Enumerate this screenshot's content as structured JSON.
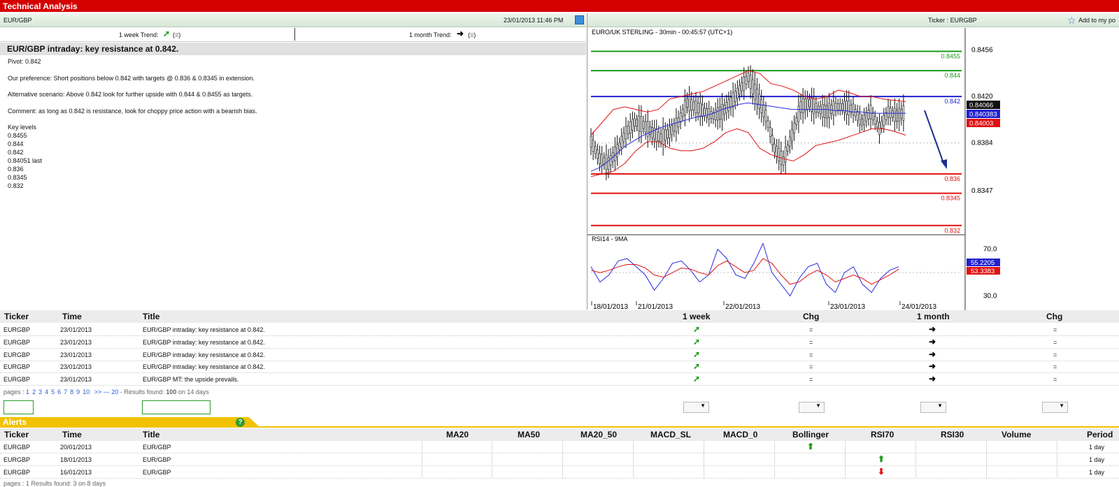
{
  "window": {
    "title": "Technical Analysis"
  },
  "header": {
    "pair": "EUR/GBP",
    "datetime": "23/01/2013 11:46 PM",
    "ticker_label": "Ticker : EURGBP",
    "add_label": "Add to my po"
  },
  "trends": {
    "week_label": "1 week Trend:",
    "week_suffix": "(=)",
    "month_label": "1 month Trend:",
    "month_suffix": "(=)"
  },
  "analysis": {
    "title": "EUR/GBP intraday: key resistance at 0.842.",
    "pivot": "Pivot: 0.842",
    "preference": "Our preference: Short positions below 0.842 with targets @ 0.836 & 0.8345 in extension.",
    "alternative": "Alternative scenario: Above 0.842 look for further upside with 0.844 & 0.8455 as targets.",
    "comment": "Comment: as long as 0.842 is resistance, look for choppy price action with a bearish bias.",
    "key_levels_label": "Key levels",
    "key_levels": [
      "0.8455",
      "0.844",
      "0.842",
      "0.84051 last",
      "0.836",
      "0.8345",
      "0.832"
    ]
  },
  "chart_data": [
    {
      "type": "line",
      "title": "EURO/UK STERLING - 30min - 00:45:57 (UTC+1)",
      "ylim": [
        0.8315,
        0.8465
      ],
      "y_ticks": [
        "0.8456",
        "0.8420",
        "0.8384",
        "0.8347"
      ],
      "x_ticks": [
        "18/01/2013",
        "21/01/2013",
        "22/01/2013",
        "23/01/2013",
        "24/01/2013"
      ],
      "levels": [
        {
          "label": "0.8455",
          "value": 0.8455,
          "color": "#1a9a1a"
        },
        {
          "label": "0.844",
          "value": 0.844,
          "color": "#1a9a1a"
        },
        {
          "label": "0.842",
          "value": 0.842,
          "color": "#2020d0"
        },
        {
          "label": "0.836",
          "value": 0.836,
          "color": "#e01010"
        },
        {
          "label": "0.8345",
          "value": 0.8345,
          "color": "#e01010"
        },
        {
          "label": "0.832",
          "value": 0.832,
          "color": "#e01010"
        }
      ],
      "price_tags": [
        {
          "label": "0.84066",
          "color": "#111111"
        },
        {
          "label": "0.840383",
          "color": "#2020d0"
        },
        {
          "label": "0.84003",
          "color": "#e01010"
        }
      ],
      "series": [
        {
          "values": [
            0.8385,
            0.8372,
            0.8368,
            0.8378,
            0.8392,
            0.84,
            0.8398,
            0.8392,
            0.8388,
            0.8392,
            0.84,
            0.8415,
            0.8412,
            0.8408,
            0.8405,
            0.8408,
            0.8415,
            0.8425,
            0.8435,
            0.842,
            0.8405,
            0.838,
            0.837,
            0.839,
            0.8412,
            0.8415,
            0.841,
            0.8408,
            0.8412,
            0.8412,
            0.841,
            0.84,
            0.8408,
            0.8395,
            0.8408,
            0.8405,
            0.8408
          ]
        },
        {
          "values": [
            0.8362,
            0.8365,
            0.837,
            0.8376,
            0.8382,
            0.8386,
            0.839,
            0.8393,
            0.8396,
            0.8398,
            0.84,
            0.8402,
            0.8404,
            0.8405,
            0.8407,
            0.841,
            0.8412,
            0.8414,
            0.8415,
            0.8414,
            0.8413,
            0.8412,
            0.8411,
            0.841,
            0.841,
            0.841,
            0.841,
            0.841,
            0.8409,
            0.8409,
            0.8408,
            0.8408,
            0.8407,
            0.8407,
            0.8407,
            0.8407,
            0.8407
          ]
        },
        {
          "values": [
            0.839,
            0.84,
            0.841,
            0.8412,
            0.841,
            0.8408,
            0.841,
            0.8418,
            0.842,
            0.8422,
            0.8424,
            0.8428,
            0.8432,
            0.8436,
            0.844,
            0.8438,
            0.843,
            0.8428,
            0.8425,
            0.842,
            0.8418,
            0.842,
            0.8425,
            0.8423,
            0.842,
            0.842,
            0.8418,
            0.8417,
            0.8416
          ]
        },
        {
          "values": [
            0.8358,
            0.836,
            0.8362,
            0.8368,
            0.8378,
            0.8385,
            0.8385,
            0.838,
            0.8378,
            0.8378,
            0.838,
            0.8385,
            0.8392,
            0.8395,
            0.8392,
            0.838,
            0.8375,
            0.8372,
            0.837,
            0.8375,
            0.8382,
            0.8384,
            0.8386,
            0.8389,
            0.8392,
            0.8395,
            0.8395,
            0.8393,
            0.839
          ]
        }
      ]
    },
    {
      "type": "line",
      "title": "RSI14 - 9MA",
      "ylim": [
        25,
        80
      ],
      "y_ticks": [
        "70.0",
        "30.0"
      ],
      "price_tags": [
        {
          "label": "55.2205",
          "color": "#2020d0"
        },
        {
          "label": "53.3383",
          "color": "#e01010"
        }
      ],
      "series": [
        {
          "values": [
            55,
            42,
            48,
            60,
            62,
            55,
            48,
            35,
            45,
            58,
            60,
            52,
            42,
            48,
            70,
            62,
            48,
            45,
            58,
            75,
            50,
            40,
            30,
            45,
            55,
            58,
            40,
            33,
            50,
            55,
            40,
            33,
            45,
            52,
            55
          ]
        },
        {
          "values": [
            52,
            50,
            52,
            55,
            57,
            57,
            54,
            48,
            46,
            50,
            54,
            53,
            50,
            48,
            56,
            60,
            55,
            50,
            52,
            62,
            58,
            48,
            40,
            42,
            48,
            52,
            48,
            42,
            45,
            48,
            45,
            40,
            44,
            48,
            53
          ]
        }
      ]
    }
  ],
  "news_table": {
    "headers": [
      "Ticker",
      "Time",
      "Title",
      "1 week",
      "Chg",
      "1 month",
      "Chg"
    ],
    "rows": [
      {
        "ticker": "EURGBP",
        "time": "23/01/2013",
        "title": "EUR/GBP intraday: key resistance at 0.842.",
        "week": "up-right-arrow",
        "chg1": "=",
        "month": "right-arrow",
        "chg2": "="
      },
      {
        "ticker": "EURGBP",
        "time": "23/01/2013",
        "title": "EUR/GBP intraday: key resistance at 0.842.",
        "week": "up-right-arrow",
        "chg1": "=",
        "month": "right-arrow",
        "chg2": "="
      },
      {
        "ticker": "EURGBP",
        "time": "23/01/2013",
        "title": "EUR/GBP intraday: key resistance at 0.842.",
        "week": "up-right-arrow",
        "chg1": "=",
        "month": "right-arrow",
        "chg2": "="
      },
      {
        "ticker": "EURGBP",
        "time": "23/01/2013",
        "title": "EUR/GBP intraday: key resistance at 0.842.",
        "week": "up-right-arrow",
        "chg1": "=",
        "month": "right-arrow",
        "chg2": "="
      },
      {
        "ticker": "EURGBP",
        "time": "23/01/2013",
        "title": "EUR/GBP MT: the upside prevails.",
        "week": "up-right-arrow",
        "chg1": "=",
        "month": "right-arrow",
        "chg2": "="
      }
    ]
  },
  "pagination": {
    "label": "pages :",
    "pages": [
      "1",
      "2",
      "3",
      "4",
      "5",
      "6",
      "7",
      "8",
      "9",
      "10"
    ],
    "more": ">> --- 20 -",
    "results_prefix": "Results found:",
    "results_count": "100",
    "results_suffix": "on 14 days"
  },
  "alerts": {
    "title": "Alerts",
    "headers": [
      "Ticker",
      "Time",
      "Title",
      "MA20",
      "MA50",
      "MA20_50",
      "MACD_SL",
      "MACD_0",
      "Bollinger",
      "RSI70",
      "RSI30",
      "Volume",
      "Period"
    ],
    "rows": [
      {
        "ticker": "EURGBP",
        "time": "20/01/2013",
        "title": "EUR/GBP",
        "bollinger": "up-arrow",
        "rsi70": "",
        "period": "1 day"
      },
      {
        "ticker": "EURGBP",
        "time": "18/01/2013",
        "title": "EUR/GBP",
        "bollinger": "",
        "rsi70": "up-arrow",
        "period": "1 day"
      },
      {
        "ticker": "EURGBP",
        "time": "16/01/2013",
        "title": "EUR/GBP",
        "bollinger": "",
        "rsi70": "down-arrow",
        "period": "1 day"
      }
    ],
    "footer": "pages : 1     Results found: 3 on 8 days"
  }
}
